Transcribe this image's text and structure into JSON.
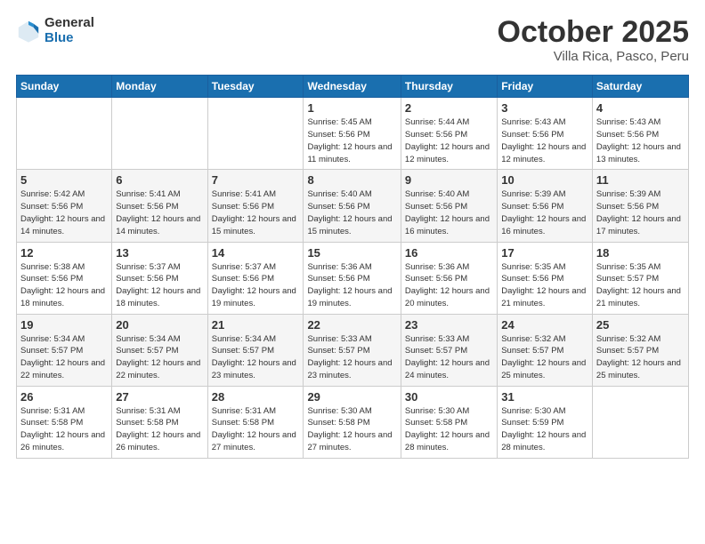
{
  "header": {
    "logo_general": "General",
    "logo_blue": "Blue",
    "month": "October 2025",
    "location": "Villa Rica, Pasco, Peru"
  },
  "weekdays": [
    "Sunday",
    "Monday",
    "Tuesday",
    "Wednesday",
    "Thursday",
    "Friday",
    "Saturday"
  ],
  "weeks": [
    [
      {
        "day": "",
        "sunrise": "",
        "sunset": "",
        "daylight": ""
      },
      {
        "day": "",
        "sunrise": "",
        "sunset": "",
        "daylight": ""
      },
      {
        "day": "",
        "sunrise": "",
        "sunset": "",
        "daylight": ""
      },
      {
        "day": "1",
        "sunrise": "Sunrise: 5:45 AM",
        "sunset": "Sunset: 5:56 PM",
        "daylight": "Daylight: 12 hours and 11 minutes."
      },
      {
        "day": "2",
        "sunrise": "Sunrise: 5:44 AM",
        "sunset": "Sunset: 5:56 PM",
        "daylight": "Daylight: 12 hours and 12 minutes."
      },
      {
        "day": "3",
        "sunrise": "Sunrise: 5:43 AM",
        "sunset": "Sunset: 5:56 PM",
        "daylight": "Daylight: 12 hours and 12 minutes."
      },
      {
        "day": "4",
        "sunrise": "Sunrise: 5:43 AM",
        "sunset": "Sunset: 5:56 PM",
        "daylight": "Daylight: 12 hours and 13 minutes."
      }
    ],
    [
      {
        "day": "5",
        "sunrise": "Sunrise: 5:42 AM",
        "sunset": "Sunset: 5:56 PM",
        "daylight": "Daylight: 12 hours and 14 minutes."
      },
      {
        "day": "6",
        "sunrise": "Sunrise: 5:41 AM",
        "sunset": "Sunset: 5:56 PM",
        "daylight": "Daylight: 12 hours and 14 minutes."
      },
      {
        "day": "7",
        "sunrise": "Sunrise: 5:41 AM",
        "sunset": "Sunset: 5:56 PM",
        "daylight": "Daylight: 12 hours and 15 minutes."
      },
      {
        "day": "8",
        "sunrise": "Sunrise: 5:40 AM",
        "sunset": "Sunset: 5:56 PM",
        "daylight": "Daylight: 12 hours and 15 minutes."
      },
      {
        "day": "9",
        "sunrise": "Sunrise: 5:40 AM",
        "sunset": "Sunset: 5:56 PM",
        "daylight": "Daylight: 12 hours and 16 minutes."
      },
      {
        "day": "10",
        "sunrise": "Sunrise: 5:39 AM",
        "sunset": "Sunset: 5:56 PM",
        "daylight": "Daylight: 12 hours and 16 minutes."
      },
      {
        "day": "11",
        "sunrise": "Sunrise: 5:39 AM",
        "sunset": "Sunset: 5:56 PM",
        "daylight": "Daylight: 12 hours and 17 minutes."
      }
    ],
    [
      {
        "day": "12",
        "sunrise": "Sunrise: 5:38 AM",
        "sunset": "Sunset: 5:56 PM",
        "daylight": "Daylight: 12 hours and 18 minutes."
      },
      {
        "day": "13",
        "sunrise": "Sunrise: 5:37 AM",
        "sunset": "Sunset: 5:56 PM",
        "daylight": "Daylight: 12 hours and 18 minutes."
      },
      {
        "day": "14",
        "sunrise": "Sunrise: 5:37 AM",
        "sunset": "Sunset: 5:56 PM",
        "daylight": "Daylight: 12 hours and 19 minutes."
      },
      {
        "day": "15",
        "sunrise": "Sunrise: 5:36 AM",
        "sunset": "Sunset: 5:56 PM",
        "daylight": "Daylight: 12 hours and 19 minutes."
      },
      {
        "day": "16",
        "sunrise": "Sunrise: 5:36 AM",
        "sunset": "Sunset: 5:56 PM",
        "daylight": "Daylight: 12 hours and 20 minutes."
      },
      {
        "day": "17",
        "sunrise": "Sunrise: 5:35 AM",
        "sunset": "Sunset: 5:56 PM",
        "daylight": "Daylight: 12 hours and 21 minutes."
      },
      {
        "day": "18",
        "sunrise": "Sunrise: 5:35 AM",
        "sunset": "Sunset: 5:57 PM",
        "daylight": "Daylight: 12 hours and 21 minutes."
      }
    ],
    [
      {
        "day": "19",
        "sunrise": "Sunrise: 5:34 AM",
        "sunset": "Sunset: 5:57 PM",
        "daylight": "Daylight: 12 hours and 22 minutes."
      },
      {
        "day": "20",
        "sunrise": "Sunrise: 5:34 AM",
        "sunset": "Sunset: 5:57 PM",
        "daylight": "Daylight: 12 hours and 22 minutes."
      },
      {
        "day": "21",
        "sunrise": "Sunrise: 5:34 AM",
        "sunset": "Sunset: 5:57 PM",
        "daylight": "Daylight: 12 hours and 23 minutes."
      },
      {
        "day": "22",
        "sunrise": "Sunrise: 5:33 AM",
        "sunset": "Sunset: 5:57 PM",
        "daylight": "Daylight: 12 hours and 23 minutes."
      },
      {
        "day": "23",
        "sunrise": "Sunrise: 5:33 AM",
        "sunset": "Sunset: 5:57 PM",
        "daylight": "Daylight: 12 hours and 24 minutes."
      },
      {
        "day": "24",
        "sunrise": "Sunrise: 5:32 AM",
        "sunset": "Sunset: 5:57 PM",
        "daylight": "Daylight: 12 hours and 25 minutes."
      },
      {
        "day": "25",
        "sunrise": "Sunrise: 5:32 AM",
        "sunset": "Sunset: 5:57 PM",
        "daylight": "Daylight: 12 hours and 25 minutes."
      }
    ],
    [
      {
        "day": "26",
        "sunrise": "Sunrise: 5:31 AM",
        "sunset": "Sunset: 5:58 PM",
        "daylight": "Daylight: 12 hours and 26 minutes."
      },
      {
        "day": "27",
        "sunrise": "Sunrise: 5:31 AM",
        "sunset": "Sunset: 5:58 PM",
        "daylight": "Daylight: 12 hours and 26 minutes."
      },
      {
        "day": "28",
        "sunrise": "Sunrise: 5:31 AM",
        "sunset": "Sunset: 5:58 PM",
        "daylight": "Daylight: 12 hours and 27 minutes."
      },
      {
        "day": "29",
        "sunrise": "Sunrise: 5:30 AM",
        "sunset": "Sunset: 5:58 PM",
        "daylight": "Daylight: 12 hours and 27 minutes."
      },
      {
        "day": "30",
        "sunrise": "Sunrise: 5:30 AM",
        "sunset": "Sunset: 5:58 PM",
        "daylight": "Daylight: 12 hours and 28 minutes."
      },
      {
        "day": "31",
        "sunrise": "Sunrise: 5:30 AM",
        "sunset": "Sunset: 5:59 PM",
        "daylight": "Daylight: 12 hours and 28 minutes."
      },
      {
        "day": "",
        "sunrise": "",
        "sunset": "",
        "daylight": ""
      }
    ]
  ]
}
